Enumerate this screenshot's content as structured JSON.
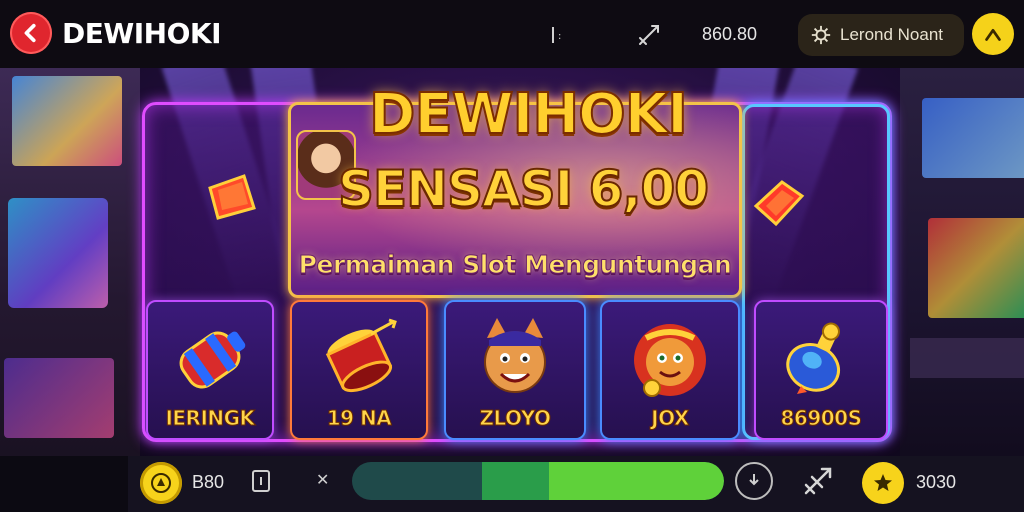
{
  "header": {
    "logo_text": "DEWIHOKI",
    "balance": "860.80",
    "login_label": "Lerond Noant",
    "icons": [
      "back-arrow-icon",
      "cursor-icon",
      "sword-icon",
      "gear-icon",
      "profile-icon"
    ]
  },
  "banner": {
    "title_line1": "DEWIHOKI",
    "title_line2": "SENSASI 6,00",
    "subtitle": "Permaiman Slot Menguntungan"
  },
  "tiles": [
    {
      "label": "IERINGK",
      "icon": "firecracker-icon"
    },
    {
      "label": "19 NA",
      "icon": "drum-icon"
    },
    {
      "label": "ZLOYO",
      "icon": "fox-mascot-icon"
    },
    {
      "label": "JOX",
      "icon": "lion-mascot-icon"
    },
    {
      "label": "86900S",
      "icon": "potion-icon"
    }
  ],
  "footer": {
    "balance": "B80",
    "win": "3030",
    "progress": {
      "dark_start": 0.35,
      "dark_end": 0.53,
      "light_end": 1.0
    },
    "icons": [
      "coin-icon",
      "card-icon",
      "close-icon",
      "download-icon",
      "share-icon",
      "star-icon"
    ]
  },
  "colors": {
    "accent_red": "#e0262e",
    "accent_yellow": "#f7d31b",
    "frame_magenta": "#e04cff",
    "frame_blue": "#58c8ff",
    "progress_track": "#1f4a4a",
    "progress_fill": "#5fd13a"
  }
}
